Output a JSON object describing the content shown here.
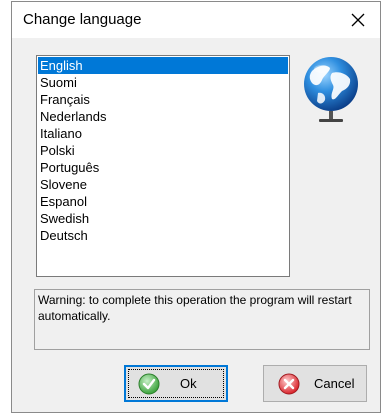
{
  "dialog": {
    "title": "Change language",
    "close_icon": "close-icon"
  },
  "languages": {
    "selected_index": 0,
    "items": [
      "English",
      "Suomi",
      "Français",
      "Nederlands",
      "Italiano",
      "Polski",
      "Português",
      "Slovene",
      "Espanol",
      "Swedish",
      "Deutsch"
    ]
  },
  "globe_icon": "globe-icon",
  "warning": {
    "text": "Warning: to complete this operation the program will restart automatically."
  },
  "buttons": {
    "ok_label": "Ok",
    "ok_icon": "checkmark-icon",
    "cancel_label": "Cancel",
    "cancel_icon": "cancel-x-icon"
  },
  "colors": {
    "selection": "#0078d7",
    "ok_icon": "#3aa23a",
    "cancel_icon": "#d9232b"
  }
}
